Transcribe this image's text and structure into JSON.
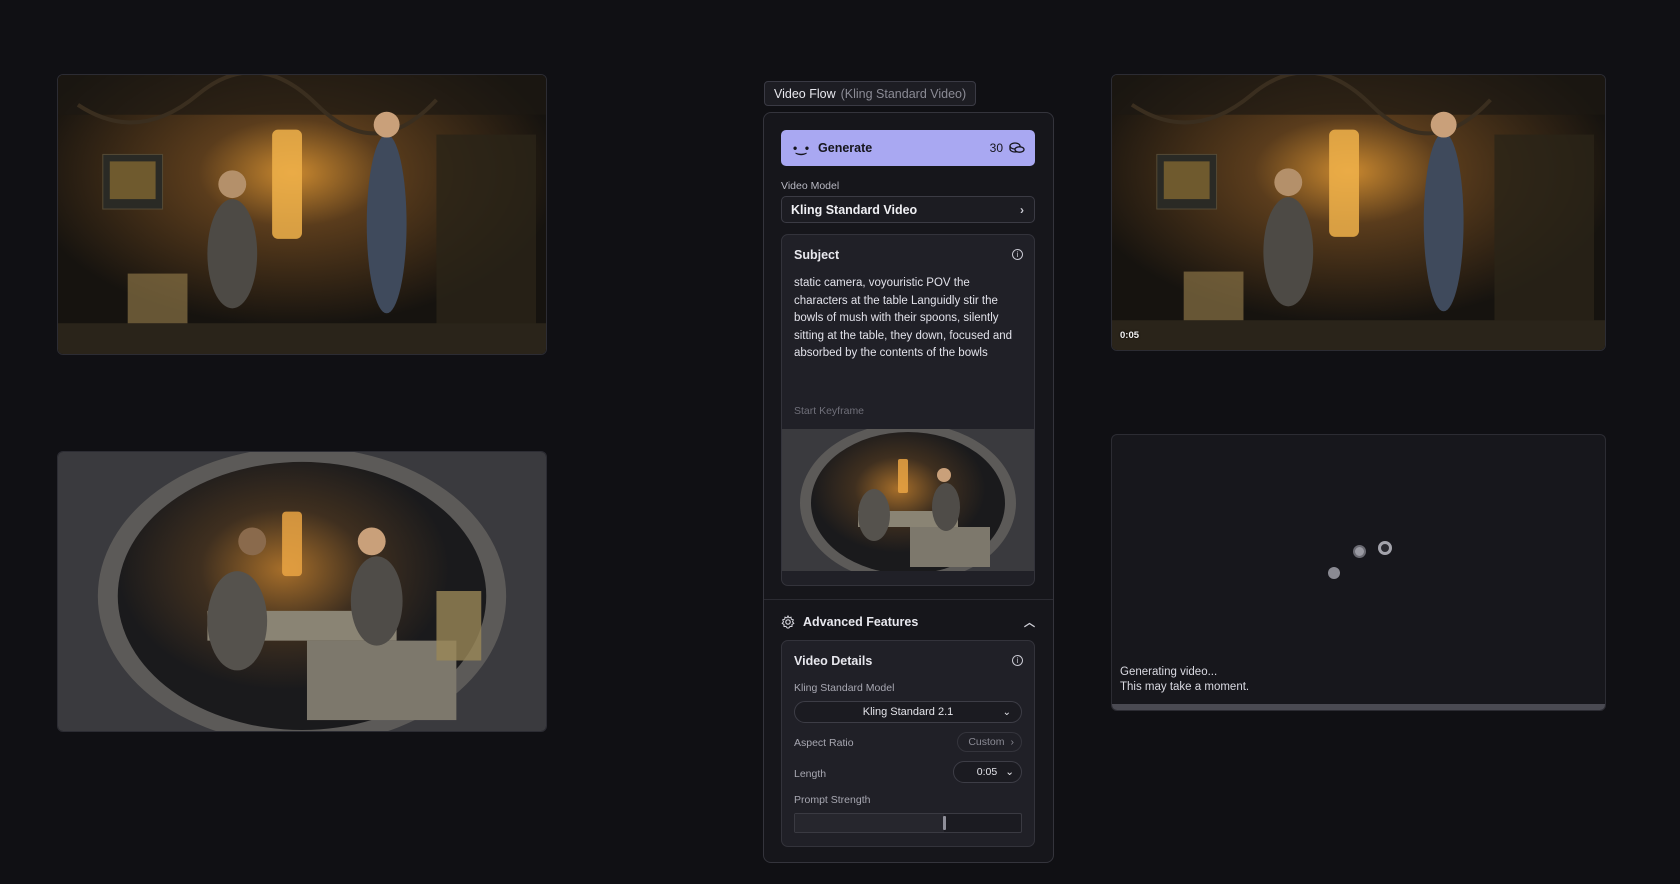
{
  "flow": {
    "title": "Video Flow",
    "subtitle": "(Kling Standard Video)"
  },
  "generate": {
    "label": "Generate",
    "cost": "30",
    "icon": "sparkle-face-icon",
    "cost_icon": "coins-icon"
  },
  "video_model": {
    "label": "Video Model",
    "value": "Kling Standard Video"
  },
  "subject": {
    "title": "Subject",
    "text": "static camera, voyouristic POV the characters at the table Languidly stir the bowls of mush with their spoons, silently sitting at the table, they down, focused and absorbed by the contents of the bowls",
    "keyframe_label": "Start Keyframe"
  },
  "advanced": {
    "label": "Advanced Features",
    "expanded": true
  },
  "details": {
    "title": "Video Details",
    "model_label": "Kling Standard Model",
    "model_value": "Kling Standard 2.1",
    "aspect_label": "Aspect Ratio",
    "aspect_value": "Custom",
    "length_label": "Length",
    "length_value": "0:05",
    "strength_label": "Prompt Strength",
    "strength_value": 0.66
  },
  "output": {
    "duration_badge": "0:05",
    "status_line1": "Generating video...",
    "status_line2": "This may take a moment."
  },
  "colors": {
    "accent": "#a9a8f2",
    "background": "#101014",
    "panel": "#16161b"
  }
}
